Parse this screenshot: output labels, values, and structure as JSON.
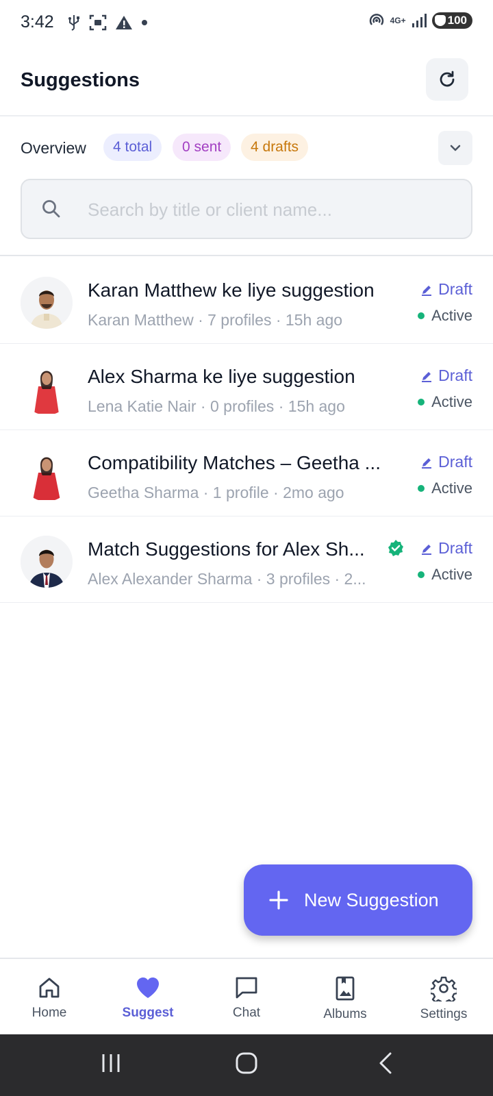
{
  "status_bar": {
    "time": "3:42",
    "network": "4G+",
    "battery": "100"
  },
  "header": {
    "title": "Suggestions"
  },
  "overview": {
    "label": "Overview",
    "badges": {
      "total": "4 total",
      "sent": "0 sent",
      "drafts": "4 drafts"
    }
  },
  "search": {
    "placeholder": "Search by title or client name...",
    "value": ""
  },
  "suggestions": [
    {
      "title": "Karan Matthew ke liye suggestion",
      "subtitle": "Karan Matthew · 7 profiles · 15h ago",
      "status": "Draft",
      "state": "Active"
    },
    {
      "title": "Alex Sharma ke liye suggestion",
      "subtitle": "Lena Katie Nair · 0 profiles · 15h ago",
      "status": "Draft",
      "state": "Active"
    },
    {
      "title": "Compatibility Matches – Geetha ...",
      "subtitle": "Geetha Sharma · 1 profile · 2mo ago",
      "status": "Draft",
      "state": "Active"
    },
    {
      "title": "Match Suggestions for Alex Sh...",
      "subtitle": "Alex Alexander Sharma · 3 profiles · 2...",
      "status": "Draft",
      "state": "Active",
      "verified": true
    }
  ],
  "fab": {
    "label": "New Suggestion"
  },
  "bottom_nav": [
    {
      "label": "Home",
      "icon": "home-icon"
    },
    {
      "label": "Suggest",
      "icon": "heart-icon",
      "active": true
    },
    {
      "label": "Chat",
      "icon": "chat-icon"
    },
    {
      "label": "Albums",
      "icon": "album-icon"
    },
    {
      "label": "Settings",
      "icon": "gear-icon"
    }
  ],
  "colors": {
    "accent": "#6366f1",
    "active_dot": "#16b37a",
    "verified": "#16b37a"
  }
}
